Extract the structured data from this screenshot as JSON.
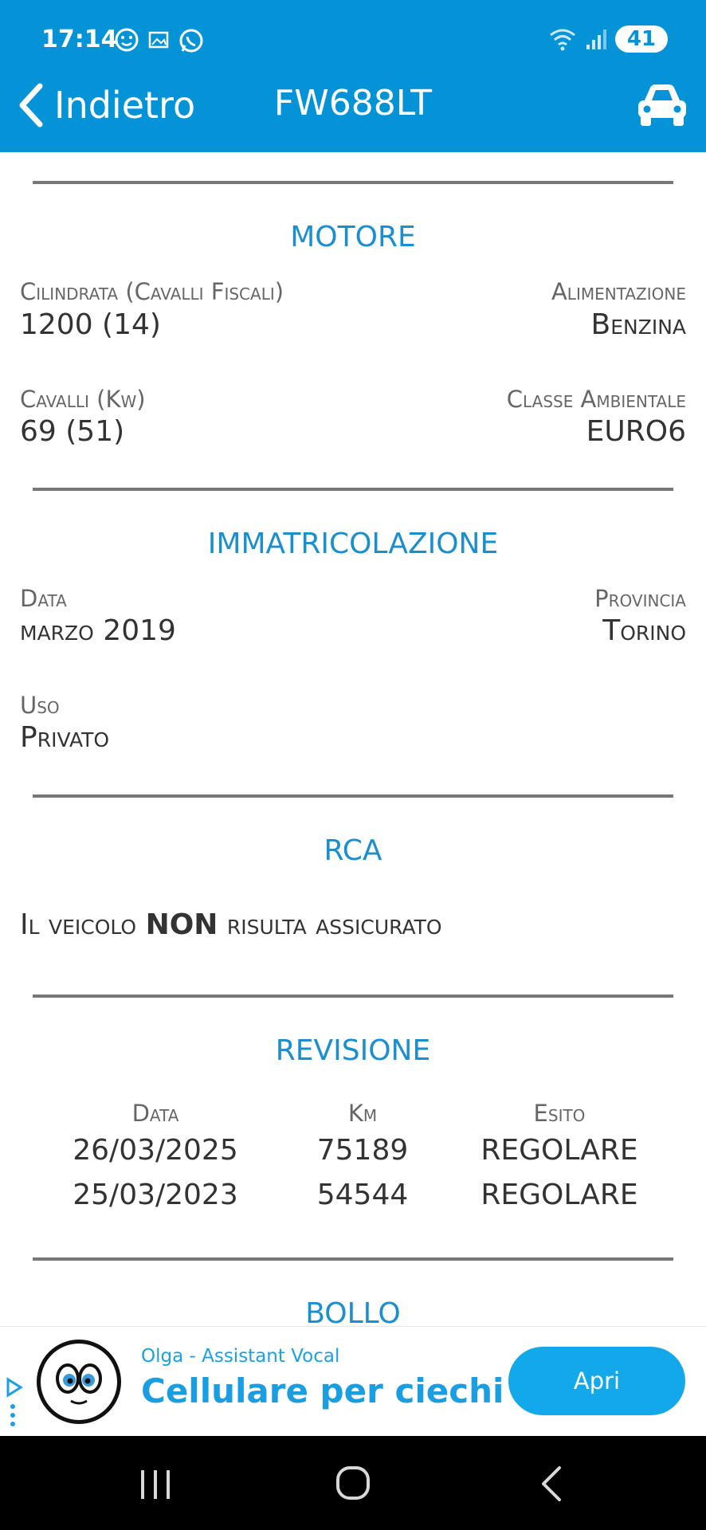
{
  "status_bar": {
    "time": "17:14",
    "battery": "41",
    "left_icons": [
      "face-icon",
      "image-icon",
      "whatsapp-icon"
    ],
    "right_icons": [
      "wifi-icon",
      "signal-icon",
      "battery-icon"
    ]
  },
  "header": {
    "back_label": "Indietro",
    "title": "FW688LT",
    "action_icon": "car-icon"
  },
  "sections": {
    "motore": {
      "title": "MOTORE",
      "cilindrata_label": "Cilindrata (Cavalli Fiscali)",
      "cilindrata_value": "1200 (14)",
      "alimentazione_label": "Alimentazione",
      "alimentazione_value": "Benzina",
      "cavalli_label": "Cavalli (Kw)",
      "cavalli_value": "69 (51)",
      "classe_label": "Classe Ambientale",
      "classe_value": "EURO6"
    },
    "immatricolazione": {
      "title": "IMMATRICOLAZIONE",
      "data_label": "Data",
      "data_value": "marzo 2019",
      "provincia_label": "Provincia",
      "provincia_value": "Torino",
      "uso_label": "Uso",
      "uso_value": "Privato"
    },
    "rca": {
      "title": "RCA",
      "text_prefix": "Il veicolo ",
      "text_bold": "NON",
      "text_suffix": " risulta assicurato"
    },
    "revisione": {
      "title": "REVISIONE",
      "columns": [
        "Data",
        "Km",
        "Esito"
      ],
      "rows": [
        [
          "26/03/2025",
          "75189",
          "REGOLARE"
        ],
        [
          "25/03/2023",
          "54544",
          "REGOLARE"
        ]
      ]
    },
    "bollo": {
      "title": "BOLLO"
    }
  },
  "ad": {
    "sponsor": "Olga - Assistant Vocal",
    "headline": "Cellulare per ciechi",
    "button": "Apri"
  },
  "colors": {
    "header_bg": "#0593d7",
    "accent": "#1a8fcf",
    "ad_button": "#13a8ea"
  }
}
